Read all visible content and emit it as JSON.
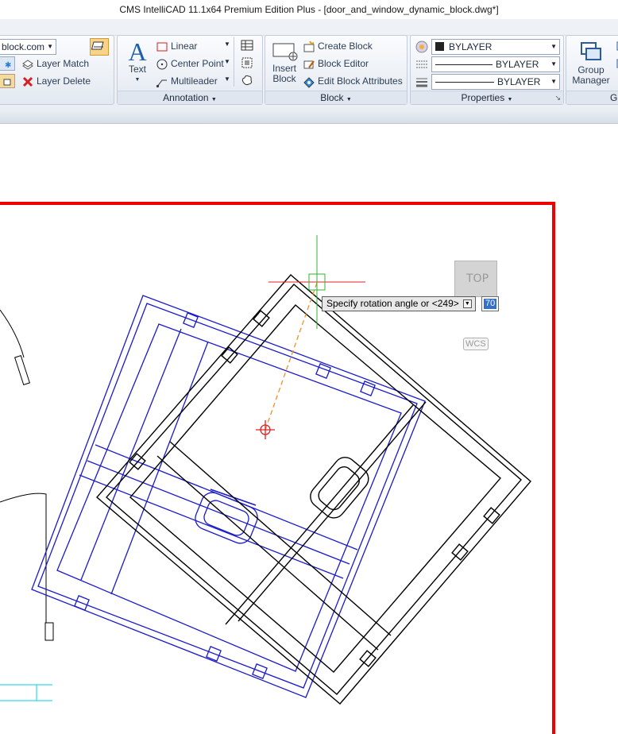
{
  "window": {
    "title": "CMS IntelliCAD 11.1x64 Premium Edition Plus  - [door_and_window_dynamic_block.dwg*]"
  },
  "layers_panel": {
    "layer_combo_value": "block.com",
    "layer_match_label": "Layer Match",
    "layer_delete_label": "Layer Delete"
  },
  "annotation_panel": {
    "label": "Annotation",
    "text_label": "Text",
    "linear_label": "Linear",
    "center_point_label": "Center Point",
    "multileader_label": "Multileader"
  },
  "block_panel": {
    "label": "Block",
    "insert_label_1": "Insert",
    "insert_label_2": "Block",
    "create_block_label": "Create Block",
    "block_editor_label": "Block Editor",
    "edit_attributes_label": "Edit Block Attributes"
  },
  "properties_panel": {
    "label": "Properties",
    "color_value": "BYLAYER",
    "linetype_value": "BYLAYER",
    "lineweight_value": "BYLAYER"
  },
  "groups_panel": {
    "group_manager_label_1": "Group",
    "group_manager_label_2": "Manager",
    "partial_label": "G"
  },
  "drawing": {
    "prompt": "Specify rotation angle or <249>",
    "input_value": "70",
    "viewcube_face": "TOP",
    "ucs_label": "WCS"
  },
  "colors": {
    "frame": "#ee0000",
    "block_highlight": "#1a1acc",
    "block_outline": "#000000",
    "crosshair_x": "#e02020",
    "crosshair_y": "#2fb52f",
    "rubberband": "#f0902a",
    "ucs_cyan": "#00d0e0"
  }
}
